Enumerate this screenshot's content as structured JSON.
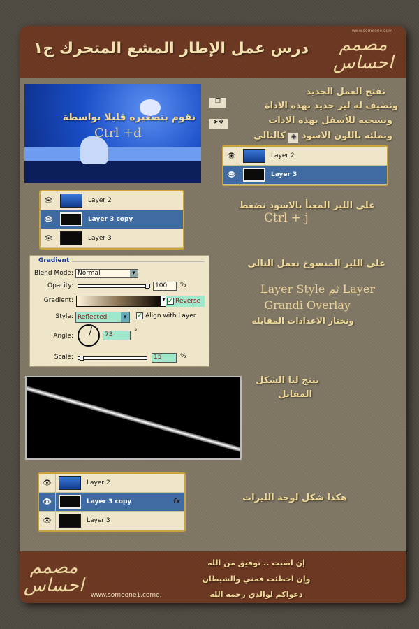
{
  "header": {
    "title": "درس عمل الإطار المشع المتحرك ج١",
    "logo": "مصمم احساس",
    "logo_url": "www.someone.com"
  },
  "step1": {
    "image_caption": "نقوم بتصغيره قليلا بواسطة",
    "image_shortcut": "Ctrl +d",
    "lines": [
      "نفتح العمل الجديد",
      "ونضيف له لير جديد بهذه الاداة",
      "ونسحبه للأسفل بهذه الادات",
      "ونملئه باللون الاسود",
      "كالتالي"
    ],
    "icons": [
      "new-layer-icon",
      "move-tool-icon",
      "paint-bucket-icon"
    ]
  },
  "layers1": [
    {
      "name": "Layer 2",
      "thumb": "blue",
      "selected": false
    },
    {
      "name": "Layer 3",
      "thumb": "black",
      "selected": true
    }
  ],
  "layers2": [
    {
      "name": "Layer 2",
      "thumb": "blue",
      "selected": false
    },
    {
      "name": "Layer 3 copy",
      "thumb": "black",
      "selected": true
    },
    {
      "name": "Layer 3",
      "thumb": "black",
      "selected": false
    }
  ],
  "step2": {
    "line": "على اللير المعبأ بالاسود نضغط",
    "shortcut": "Ctrl + j"
  },
  "gradient_panel": {
    "title": "Gradient",
    "blend_mode_label": "Blend Mode:",
    "blend_mode": "Normal",
    "opacity_label": "Opacity:",
    "opacity": "100",
    "opacity_value": 100,
    "percent": "%",
    "gradient_label": "Gradient:",
    "reverse_label": "Reverse",
    "reverse": true,
    "style_label": "Style:",
    "style": "Reflected",
    "align_label": "Align with Layer",
    "align": true,
    "angle_label": "Angle:",
    "angle": "73",
    "degree": "°",
    "scale_label": "Scale:",
    "scale": "15",
    "scale_value": 15
  },
  "step3": {
    "line1": "على اللير المنسوخ نعمل التالي",
    "line2": "Layer Style ثم Layer",
    "line2_ar": "ثم",
    "line3": "Grandi Overlay",
    "line4": "ونختار الاعدادات المقابله"
  },
  "step4": {
    "line1": "ينتج لنا الشكل",
    "line2": "المقابل"
  },
  "layers3": [
    {
      "name": "Layer 2",
      "thumb": "blue",
      "selected": false
    },
    {
      "name": "Layer 3 copy",
      "thumb": "black",
      "selected": true,
      "fx": "fx"
    },
    {
      "name": "Layer 3",
      "thumb": "black",
      "selected": false
    }
  ],
  "step5": {
    "line": "هكذا شكل لوحة الليرات"
  },
  "footer": {
    "lines": [
      "إن اصبت .. توفيق من الله",
      "وإن اخطئت فمني والشيطان",
      "دعواكم لوالدي رحمه الله"
    ],
    "url": "www.someone1.come.",
    "logo": "مصمم احساس"
  }
}
